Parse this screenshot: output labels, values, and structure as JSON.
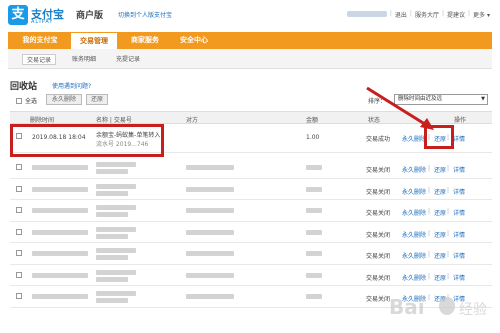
{
  "header": {
    "logo_glyph": "支",
    "logo_text": "支付宝",
    "logo_sub": "ALIPAY",
    "edition": "商户版",
    "switch_link": "切换到个人版支付宝",
    "links": [
      "退出",
      "服务大厅",
      "提建议",
      "更多"
    ]
  },
  "nav": {
    "tabs": [
      "我的支付宝",
      "交易管理",
      "商家服务",
      "安全中心"
    ],
    "active_index": 1
  },
  "subnav": {
    "tabs": [
      "交易记录",
      "账务明细",
      "充提记录"
    ],
    "active_index": 0
  },
  "page": {
    "title": "回收站",
    "help_link": "使用遇到问题?"
  },
  "toolbar": {
    "select_all": "全选",
    "delete_button": "永久删除",
    "restore_button": "还原",
    "sort_label": "排序：",
    "sort_value": "删除时间由近及远"
  },
  "table": {
    "headers": [
      "删除时间",
      "名称 | 交易号",
      "对方",
      "金额",
      "状态",
      "操作"
    ],
    "first_row": {
      "time": "2019.08.18 18:04",
      "name": "余额宝-蚂蚁集-单笔转入",
      "trade_no": "流水号 2019...746",
      "amount": "1.00",
      "status": "交易成功"
    },
    "actions": {
      "delete": "永久删除",
      "restore": "还原",
      "detail": "详情"
    },
    "row_statuses": [
      "交易成功",
      "交易关闭",
      "交易关闭",
      "交易关闭",
      "交易关闭",
      "交易关闭",
      "交易关闭",
      "交易关闭"
    ]
  },
  "colors": {
    "nav_orange": "#f29a1f",
    "link_blue": "#1a6dbf",
    "annotation_red": "#c81e1e"
  }
}
